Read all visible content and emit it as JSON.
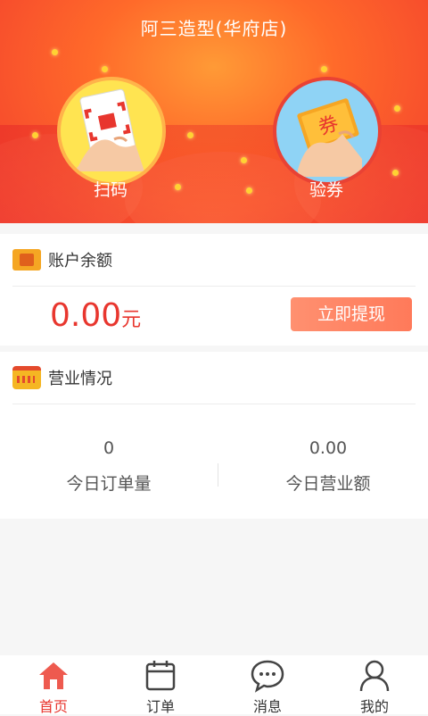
{
  "header": {
    "title": "阿三造型(华府店)",
    "actions": [
      {
        "label": "扫码",
        "icon": "qr-scan-icon"
      },
      {
        "label": "验券",
        "icon": "coupon-icon"
      }
    ],
    "coupon_text": "券"
  },
  "balance": {
    "title": "账户余额",
    "amount": "0.00",
    "unit": "元",
    "withdraw_label": "立即提现"
  },
  "business": {
    "title": "营业情况",
    "stats": [
      {
        "value": "0",
        "label": "今日订单量"
      },
      {
        "value": "0.00",
        "label": "今日营业额"
      }
    ]
  },
  "tabbar": {
    "items": [
      {
        "label": "首页",
        "icon": "home-icon",
        "active": true
      },
      {
        "label": "订单",
        "icon": "calendar-icon",
        "active": false
      },
      {
        "label": "消息",
        "icon": "message-icon",
        "active": false
      },
      {
        "label": "我的",
        "icon": "user-icon",
        "active": false
      }
    ]
  },
  "colors": {
    "accent": "#e8362e",
    "header_gradient": [
      "#ff9a36",
      "#f23c2e"
    ],
    "button": "#ff8566"
  }
}
